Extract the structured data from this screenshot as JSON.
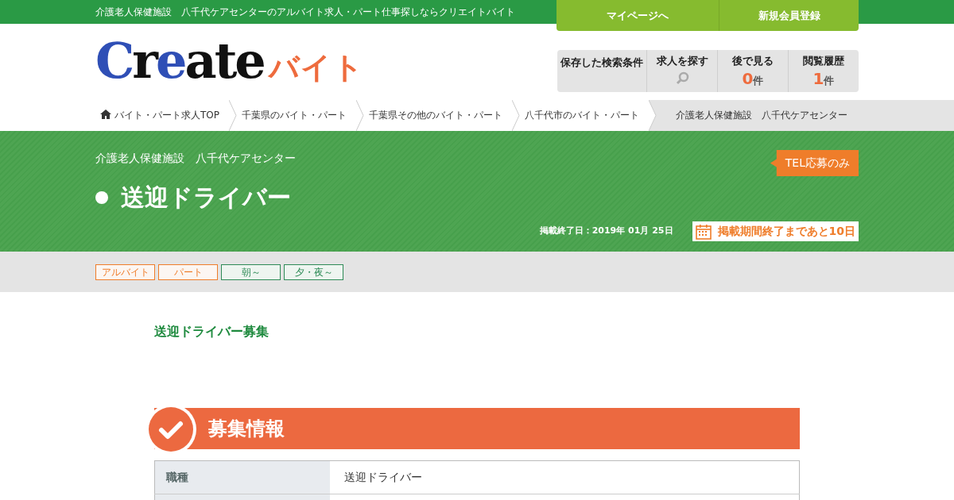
{
  "top_bar": {
    "tagline": "介護老人保健施設　八千代ケアセンターのアルバイト求人・パート仕事探しならクリエイトバイト",
    "buttons": [
      "マイページへ",
      "新規会員登録"
    ]
  },
  "logo": {
    "parts": [
      {
        "text": "C",
        "color": "#2f4fb6"
      },
      {
        "text": "r",
        "color": "#111111"
      },
      {
        "text": "e",
        "color": "#2f4fb6"
      },
      {
        "text": "ate",
        "color": "#111111"
      },
      {
        "text": "バイト",
        "color": "#ee6b3d"
      }
    ]
  },
  "header_menu": [
    {
      "kind": "text",
      "label": "保存した検索条件"
    },
    {
      "kind": "search",
      "label": "求人を探す"
    },
    {
      "kind": "count",
      "label": "後で見る",
      "count": "0",
      "unit": "件"
    },
    {
      "kind": "count",
      "label": "閲覧履歴",
      "count": "1",
      "unit": "件"
    }
  ],
  "breadcrumb": [
    {
      "label": "バイト・パート求人TOP",
      "current": false
    },
    {
      "label": "千葉県のバイト・パート",
      "current": false
    },
    {
      "label": "千葉県その他のバイト・パート",
      "current": false
    },
    {
      "label": "八千代市のバイト・パート",
      "current": false
    },
    {
      "label": "介護老人保健施設　八千代ケアセンター",
      "current": true
    }
  ],
  "job_header": {
    "company": "介護老人保健施設　八千代ケアセンター",
    "badge": "TEL応募のみ",
    "title": "送迎ドライバー",
    "end_date": "掲載終了日：2019年 01月 25日",
    "remaining": "掲載期間終了まであと10日"
  },
  "tags": [
    {
      "label": "アルバイト",
      "kind": "employment"
    },
    {
      "label": "パート",
      "kind": "employment"
    },
    {
      "label": "朝～",
      "kind": "time"
    },
    {
      "label": "夕・夜～",
      "kind": "time"
    }
  ],
  "catch": "送迎ドライバー募集",
  "section": {
    "title": "募集情報",
    "rows": [
      {
        "label": "職種",
        "value": "送迎ドライバー"
      }
    ]
  }
}
